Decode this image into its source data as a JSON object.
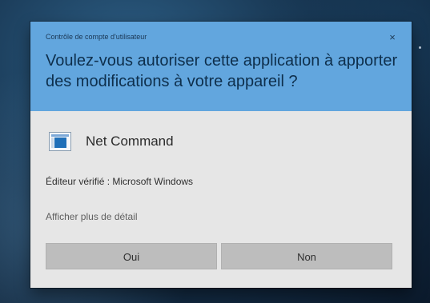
{
  "dialog": {
    "caption": "Contrôle de compte d'utilisateur",
    "close_label": "×",
    "question": "Voulez-vous autoriser cette application à apporter des modifications à votre appareil ?",
    "app_name": "Net Command",
    "publisher": "Éditeur vérifié : Microsoft Windows",
    "details_link": "Afficher plus de détail",
    "buttons": {
      "yes": "Oui",
      "no": "Non"
    },
    "icons": {
      "app": "net-command-app-icon",
      "close": "close-icon"
    },
    "colors": {
      "header": "#62a6de",
      "body": "#e6e6e6",
      "button": "#bdbdbd",
      "accent": "#1f6fb8"
    }
  }
}
